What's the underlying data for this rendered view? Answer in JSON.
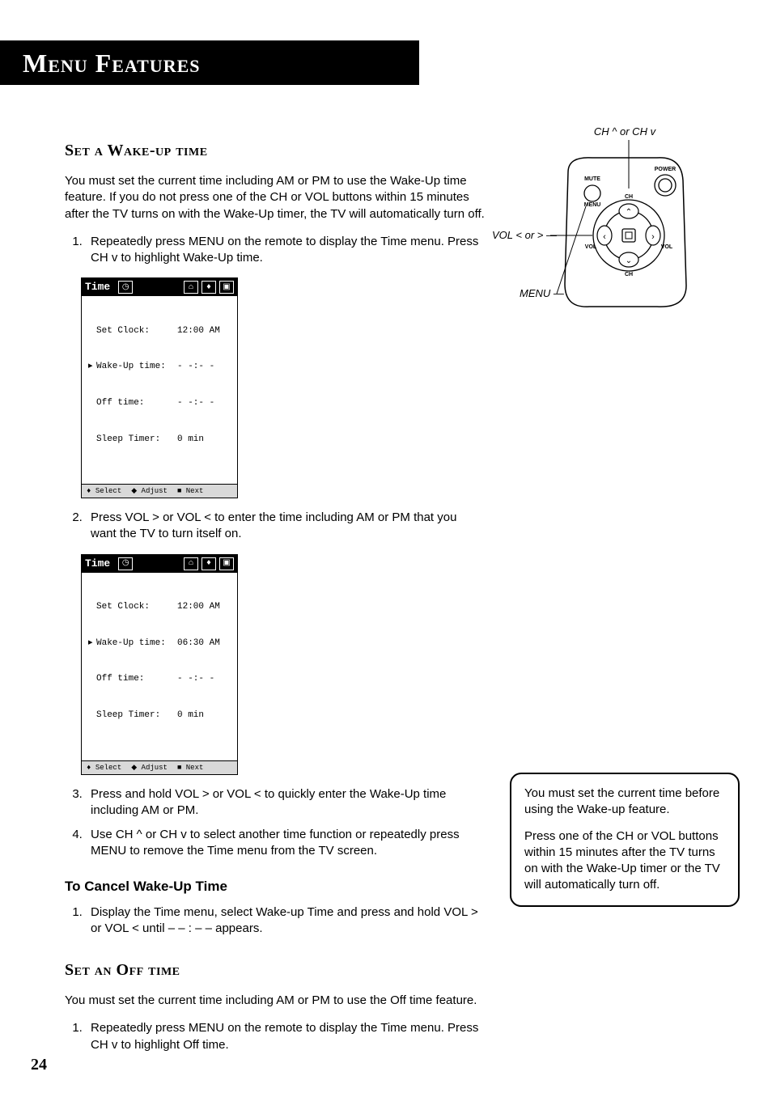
{
  "banner": "Menu Features",
  "section1": {
    "heading": "Set a Wake-up time",
    "intro": "You must set the current time including AM or PM to use the Wake-Up time feature. If you do not press one of the CH or VOL buttons within 15 minutes after the TV turns on with the Wake-Up timer, the TV will automatically turn off.",
    "step1": "Repeatedly press MENU on the remote to display the Time menu. Press CH v to highlight Wake-Up time.",
    "step2": "Press VOL > or VOL <  to enter the time including AM or PM that you want the TV to turn itself on.",
    "step3": "Press and hold VOL > or VOL <  to quickly enter the Wake-Up time including AM or PM.",
    "step4": "Use CH ^ or CH v to select another time function or repeatedly press MENU to remove the Time menu from the TV screen."
  },
  "menu": {
    "title": "Time",
    "rows": {
      "setClock": "Set Clock:",
      "wakeUp": "Wake-Up time:",
      "offTime": "Off time:",
      "sleep": "Sleep Timer:"
    },
    "values1": {
      "setClock": "12:00 AM",
      "wakeUp": "- -:- -",
      "offTime": "- -:- -",
      "sleep": "0 min"
    },
    "values2": {
      "setClock": "12:00 AM",
      "wakeUp": "06:30 AM",
      "offTime": "- -:- -",
      "sleep": "0 min"
    },
    "footer": {
      "select": "Select",
      "adjust": "Adjust",
      "next": "Next"
    }
  },
  "cancel": {
    "heading": "To Cancel Wake-Up Time",
    "step1": "Display the Time menu, select Wake-up Time and press and hold VOL > or VOL <  until – – : – – appears."
  },
  "section2": {
    "heading": "Set an Off time",
    "intro": "You must set the current time including AM or PM to use the Off time feature.",
    "step1": "Repeatedly press MENU on the remote to display the Time menu. Press CH v to highlight Off time."
  },
  "remote": {
    "chLabel": "CH ^ or CH v",
    "volLabel": "VOL  < or >",
    "menuLabel": "MENU",
    "mute": "MUTE",
    "power": "POWER",
    "ch": "CH",
    "vol": "VOL",
    "menu": "MENU"
  },
  "note": {
    "p1": "You must set the current time before using the Wake-up feature.",
    "p2": "Press one of the CH or VOL buttons within 15 minutes after the TV turns on with the Wake-Up timer or the TV will automatically turn off."
  },
  "pageNum": "24"
}
